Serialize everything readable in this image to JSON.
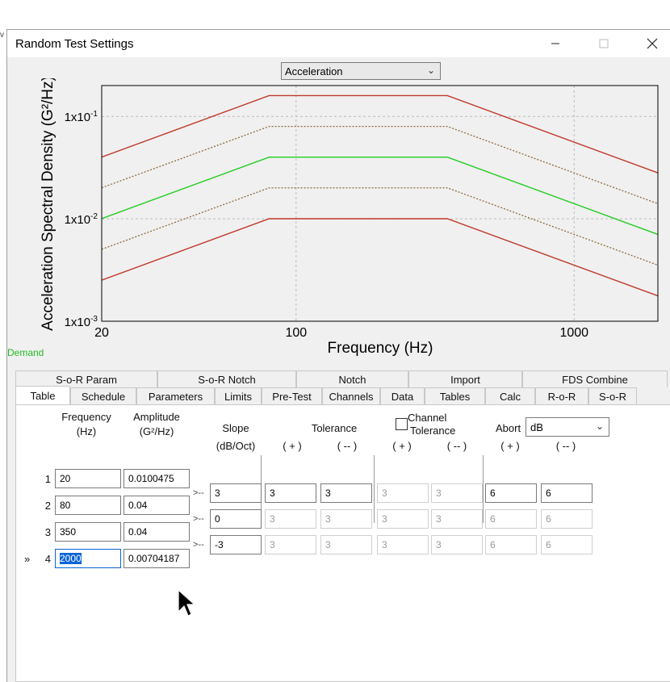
{
  "window": {
    "title": "Random Test Settings",
    "desk_char": "v"
  },
  "view_select": {
    "value": "Acceleration"
  },
  "chart_data": {
    "type": "line",
    "xscale": "log",
    "yscale": "log",
    "xlim": [
      20,
      2000
    ],
    "ylim": [
      0.001,
      0.2
    ],
    "xticks": [
      "20",
      "100",
      "1000"
    ],
    "yticks": [
      "1x10-1",
      "1x10-2",
      "1x10-3"
    ],
    "xlabel": "Frequency (Hz)",
    "ylabel": "Acceleration Spectral Density (G²/Hz)",
    "grid": true,
    "series": [
      {
        "name": "Demand",
        "color": "#22cc22",
        "style": "solid",
        "x": [
          20,
          80,
          350,
          2000
        ],
        "y": [
          0.0100475,
          0.04,
          0.04,
          0.00704187
        ]
      },
      {
        "color": "#c0392b",
        "style": "solid",
        "x": [
          20,
          80,
          350,
          2000
        ],
        "y": [
          0.0401,
          0.1596,
          0.1596,
          0.0281
        ]
      },
      {
        "color": "#c0392b",
        "style": "solid",
        "x": [
          20,
          80,
          350,
          2000
        ],
        "y": [
          0.00252,
          0.01002,
          0.01002,
          0.00177
        ]
      },
      {
        "color": "#8b6a3a",
        "style": "dotted",
        "x": [
          20,
          80,
          350,
          2000
        ],
        "y": [
          0.0201,
          0.0798,
          0.0798,
          0.01405
        ]
      },
      {
        "color": "#8b6a3a",
        "style": "dotted",
        "x": [
          20,
          80,
          350,
          2000
        ],
        "y": [
          0.00504,
          0.02005,
          0.02005,
          0.00353
        ]
      }
    ],
    "legend_text": "Demand"
  },
  "tabs_row1": [
    "S-o-R Param",
    "S-o-R Notch",
    "Notch",
    "Import",
    "FDS Combine"
  ],
  "tabs_row2": [
    "Table",
    "Schedule",
    "Parameters",
    "Limits",
    "Pre-Test",
    "Channels",
    "Data",
    "Tables",
    "Calc",
    "R-o-R",
    "S-o-R"
  ],
  "active_tab": "Table",
  "table": {
    "freq_header": "Frequency",
    "freq_unit": "(Hz)",
    "amp_header": "Amplitude",
    "amp_unit": "(G²/Hz)",
    "slope_header": "Slope",
    "slope_unit": "(dB/Oct)",
    "tol_header": "Tolerance",
    "chan_tol_1": "Channel",
    "chan_tol_2": "Tolerance",
    "abort_header": "Abort",
    "abort_mode": "dB",
    "plus": "( + )",
    "minus": "( -- )",
    "current_marker": "»",
    "seg_arrow": ">--",
    "rows": [
      {
        "n": "1",
        "freq": "20",
        "amp": "0.0100475"
      },
      {
        "n": "2",
        "freq": "80",
        "amp": "0.04"
      },
      {
        "n": "3",
        "freq": "350",
        "amp": "0.04"
      },
      {
        "n": "4",
        "freq": "2000",
        "amp": "0.00704187"
      }
    ],
    "segments": [
      {
        "slope": "3",
        "tol_p": "3",
        "tol_m": "3",
        "ch_p": "3",
        "ch_m": "3",
        "ab_p": "6",
        "ab_m": "6"
      },
      {
        "slope": "0",
        "tol_p": "3",
        "tol_m": "3",
        "ch_p": "3",
        "ch_m": "3",
        "ab_p": "6",
        "ab_m": "6"
      },
      {
        "slope": "-3",
        "tol_p": "3",
        "tol_m": "3",
        "ch_p": "3",
        "ch_m": "3",
        "ab_p": "6",
        "ab_m": "6"
      }
    ]
  }
}
